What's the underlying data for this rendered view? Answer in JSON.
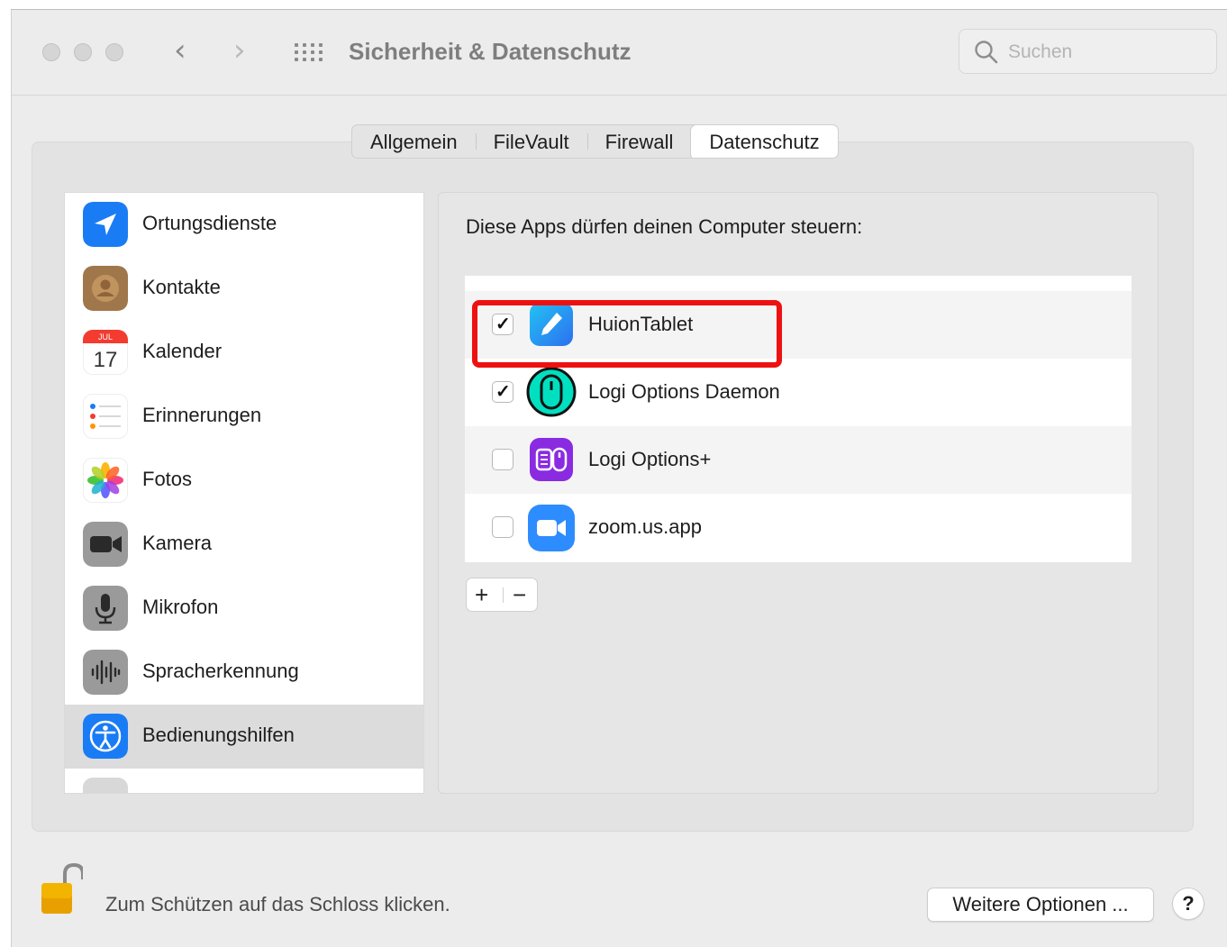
{
  "window": {
    "title": "Sicherheit & Datenschutz"
  },
  "search": {
    "placeholder": "Suchen"
  },
  "tabs": [
    {
      "label": "Allgemein",
      "active": false
    },
    {
      "label": "FileVault",
      "active": false
    },
    {
      "label": "Firewall",
      "active": false
    },
    {
      "label": "Datenschutz",
      "active": true
    }
  ],
  "sidebar": {
    "items": [
      {
        "label": "Ortungsdienste",
        "icon": "location-icon"
      },
      {
        "label": "Kontakte",
        "icon": "contacts-icon"
      },
      {
        "label": "Kalender",
        "icon": "calendar-icon",
        "calendar_month": "JUL",
        "calendar_day": "17"
      },
      {
        "label": "Erinnerungen",
        "icon": "reminders-icon"
      },
      {
        "label": "Fotos",
        "icon": "photos-icon"
      },
      {
        "label": "Kamera",
        "icon": "camera-icon"
      },
      {
        "label": "Mikrofon",
        "icon": "microphone-icon"
      },
      {
        "label": "Spracherkennung",
        "icon": "speech-recognition-icon"
      },
      {
        "label": "Bedienungshilfen",
        "icon": "accessibility-icon",
        "selected": true
      }
    ]
  },
  "panel": {
    "caption": "Diese Apps dürfen deinen Computer steuern:",
    "apps": [
      {
        "label": "HuionTablet",
        "checked": true,
        "icon": "huion-tablet-icon"
      },
      {
        "label": "Logi Options Daemon",
        "checked": true,
        "icon": "logi-daemon-icon"
      },
      {
        "label": "Logi Options+",
        "checked": false,
        "icon": "logi-options-plus-icon"
      },
      {
        "label": "zoom.us.app",
        "checked": false,
        "icon": "zoom-icon"
      }
    ],
    "add_label": "+",
    "remove_label": "−",
    "highlight_color": "#ee1111"
  },
  "footer": {
    "lock_text": "Zum Schützen auf das Schloss klicken.",
    "more_options": "Weitere Optionen ...",
    "help": "?"
  },
  "colors": {
    "accent_blue": "#1a7cf5",
    "zoom_blue": "#2d8cff",
    "logi_purple": "#8a2be2",
    "logi_teal": "#00e0c0"
  }
}
